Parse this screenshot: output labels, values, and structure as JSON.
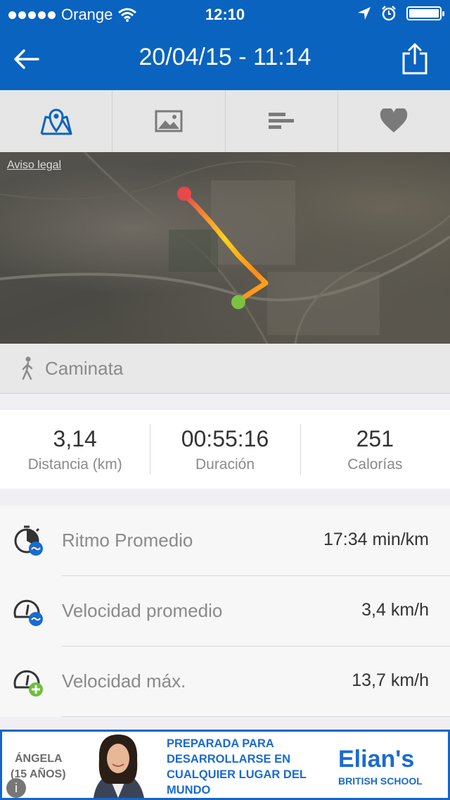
{
  "status_bar": {
    "carrier": "Orange",
    "time": "12:10"
  },
  "nav": {
    "title": "20/04/15 - 11:14",
    "back_icon": "back-arrow-icon",
    "share_icon": "share-icon"
  },
  "tabs": [
    {
      "icon": "map-pin-icon",
      "active": true
    },
    {
      "icon": "image-icon",
      "active": false
    },
    {
      "icon": "bars-icon",
      "active": false
    },
    {
      "icon": "heart-icon",
      "active": false
    }
  ],
  "map": {
    "legal": "Aviso legal"
  },
  "activity": {
    "type": "Caminata",
    "icon": "walking-person-icon"
  },
  "stats": {
    "distance": {
      "value": "3,14",
      "label": "Distancia (km)"
    },
    "duration": {
      "value": "00:55:16",
      "label": "Duración"
    },
    "calories": {
      "value": "251",
      "label": "Calorías"
    }
  },
  "metrics": [
    {
      "name": "Ritmo Promedio",
      "value": "17:34 min/km",
      "icon": "pace-average-icon"
    },
    {
      "name": "Velocidad promedio",
      "value": "3,4 km/h",
      "icon": "speed-average-icon"
    },
    {
      "name": "Velocidad máx.",
      "value": "13,7 km/h",
      "icon": "speed-max-icon"
    }
  ],
  "ad": {
    "name_line1": "ÁNGELA",
    "name_line2": "(15 AÑOS)",
    "slogan": "PREPARADA PARA DESARROLLARSE EN CUALQUIER LUGAR DEL MUNDO",
    "brand": "Elian's",
    "school": "BRITISH SCHOOL",
    "info_icon": "info-icon"
  },
  "colors": {
    "header": "#0a63bf",
    "accent": "#0a63bf",
    "route_start": "#7cc242",
    "route_end": "#e8474b"
  }
}
